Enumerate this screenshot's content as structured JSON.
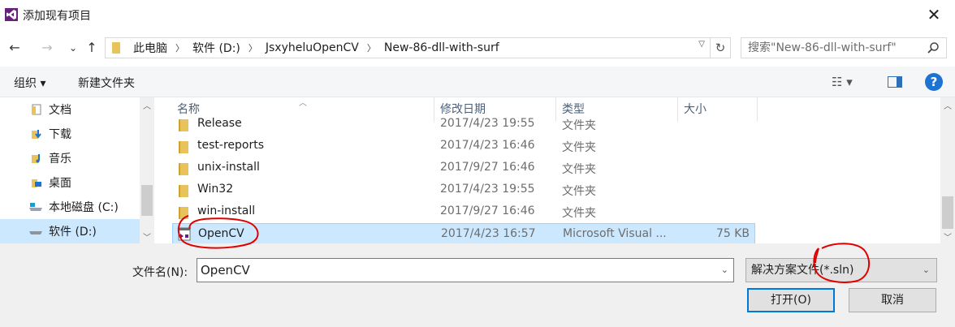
{
  "window": {
    "title": "添加现有项目",
    "close_symbol": "✕"
  },
  "nav": {
    "back_symbol": "←",
    "forward_symbol": "→",
    "dropdown_symbol": "⌄",
    "up_symbol": "↑",
    "breadcrumbs": [
      "此电脑",
      "软件 (D:)",
      "JsxyheluOpenCV",
      "New-86-dll-with-surf"
    ],
    "refresh_symbol": "↻",
    "search_placeholder": "搜索\"New-86-dll-with-surf\""
  },
  "toolbar": {
    "organize_label": "组织 ▾",
    "new_folder_label": "新建文件夹",
    "view_symbol": "☷ ▾",
    "help_symbol": "?"
  },
  "sidebar": {
    "items": [
      {
        "label": "文档",
        "icon": "documents-icon"
      },
      {
        "label": "下载",
        "icon": "downloads-icon"
      },
      {
        "label": "音乐",
        "icon": "music-icon"
      },
      {
        "label": "桌面",
        "icon": "desktop-icon"
      },
      {
        "label": "本地磁盘 (C:)",
        "icon": "drive-c-icon"
      },
      {
        "label": "软件 (D:)",
        "icon": "drive-d-icon",
        "selected": true
      }
    ]
  },
  "filelist": {
    "columns": [
      "名称",
      "修改日期",
      "类型",
      "大小"
    ],
    "rows": [
      {
        "name": "Release",
        "date": "2017/4/23 19:55",
        "type": "文件夹",
        "size": "",
        "kind": "folder"
      },
      {
        "name": "test-reports",
        "date": "2017/4/23 16:46",
        "type": "文件夹",
        "size": "",
        "kind": "folder"
      },
      {
        "name": "unix-install",
        "date": "2017/9/27 16:46",
        "type": "文件夹",
        "size": "",
        "kind": "folder"
      },
      {
        "name": "Win32",
        "date": "2017/4/23 19:55",
        "type": "文件夹",
        "size": "",
        "kind": "folder"
      },
      {
        "name": "win-install",
        "date": "2017/9/27 16:46",
        "type": "文件夹",
        "size": "",
        "kind": "folder"
      },
      {
        "name": "OpenCV",
        "date": "2017/4/23 16:57",
        "type": "Microsoft Visual ...",
        "size": "75 KB",
        "kind": "sln",
        "selected": true
      }
    ]
  },
  "footer": {
    "filename_label": "文件名(N):",
    "filename_value": "OpenCV",
    "filter_value": "解决方案文件(*.sln)",
    "open_label": "打开(O)",
    "cancel_label": "取消"
  },
  "colors": {
    "selection": "#cce8ff",
    "accent": "#0078d7",
    "annotation": "#e00000"
  }
}
